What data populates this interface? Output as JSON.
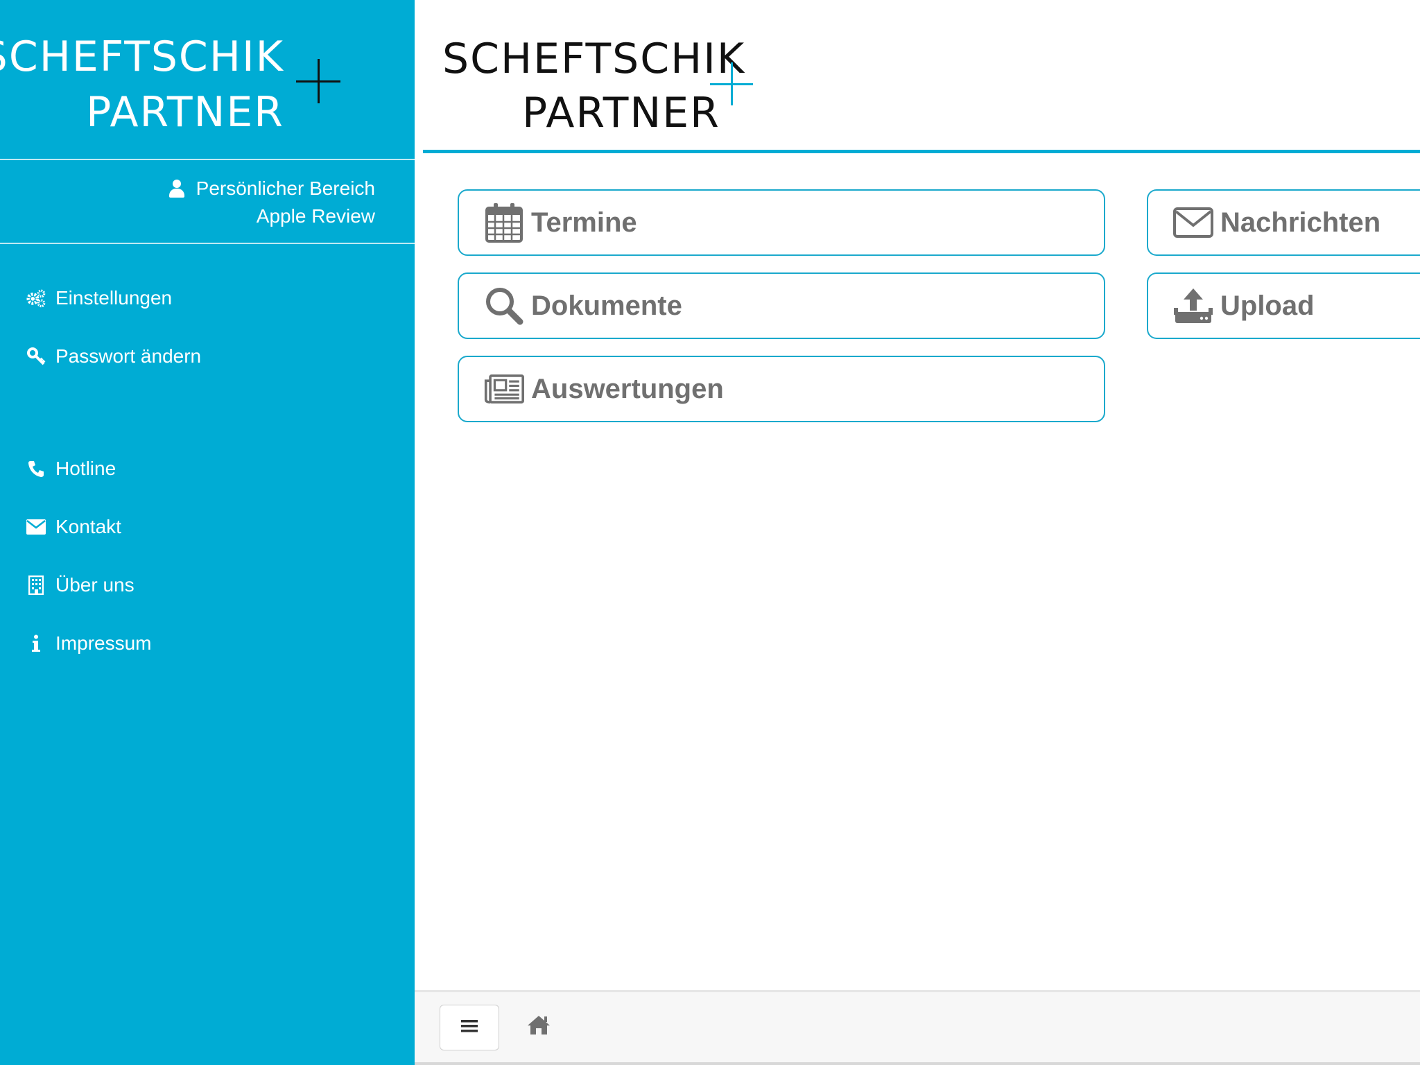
{
  "brand": {
    "line1": "SCHEFTSCHIK",
    "line2": "PARTNER"
  },
  "colors": {
    "accent": "#00acd4",
    "tile_border": "#1aa9cc",
    "tile_text": "#707070"
  },
  "user": {
    "section_label": "Persönlicher Bereich",
    "name": "Apple Review",
    "icon": "user-icon"
  },
  "sidebar": {
    "items": [
      {
        "label": "Einstellungen",
        "icon": "gears-icon"
      },
      {
        "label": "Passwort ändern",
        "icon": "key-icon"
      },
      {
        "label": "Hotline",
        "icon": "phone-icon"
      },
      {
        "label": "Kontakt",
        "icon": "envelope-icon"
      },
      {
        "label": "Über uns",
        "icon": "building-icon"
      },
      {
        "label": "Impressum",
        "icon": "info-icon"
      }
    ]
  },
  "tiles": [
    {
      "label": "Termine",
      "icon": "calendar-icon"
    },
    {
      "label": "Dokumente",
      "icon": "search-icon"
    },
    {
      "label": "Auswertungen",
      "icon": "newspaper-icon"
    },
    {
      "label": "Nachrichten",
      "icon": "envelope-icon"
    },
    {
      "label": "Upload",
      "icon": "upload-icon"
    }
  ],
  "bottombar": {
    "menu_icon": "hamburger-icon",
    "home_icon": "home-icon"
  }
}
